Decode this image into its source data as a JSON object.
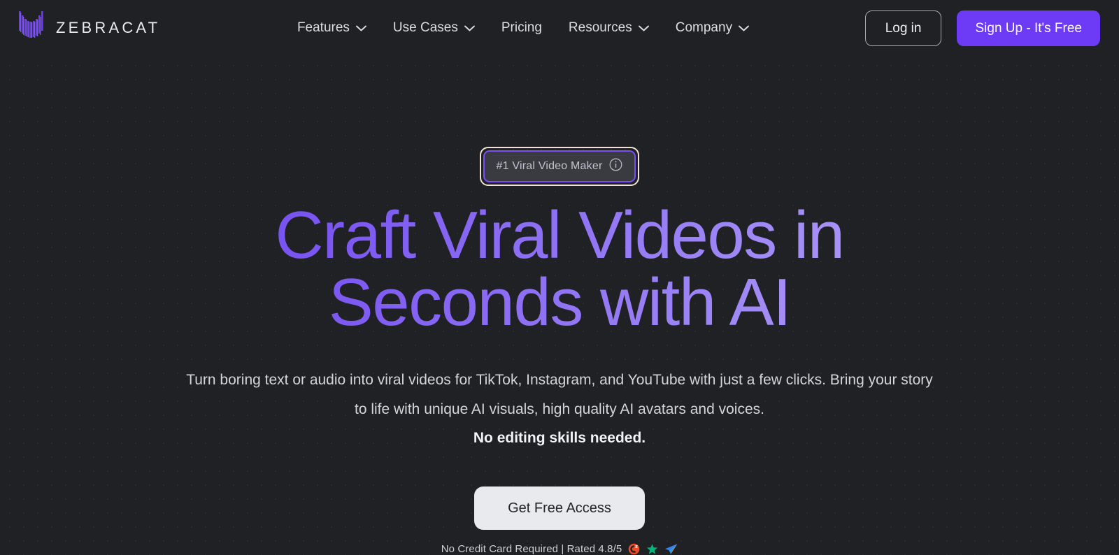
{
  "brand": {
    "name": "ZEBRACAT",
    "logo_icon": "zebracat-bars-logo",
    "accent": "#6d3bf5"
  },
  "nav": {
    "items": [
      {
        "label": "Features",
        "has_dropdown": true,
        "icon": "chevron-down-icon"
      },
      {
        "label": "Use Cases",
        "has_dropdown": true,
        "icon": "chevron-down-icon"
      },
      {
        "label": "Pricing",
        "has_dropdown": false,
        "icon": ""
      },
      {
        "label": "Resources",
        "has_dropdown": true,
        "icon": "chevron-down-icon"
      },
      {
        "label": "Company",
        "has_dropdown": true,
        "icon": "chevron-down-icon"
      }
    ]
  },
  "auth": {
    "login_label": "Log in",
    "signup_label": "Sign Up - It's Free",
    "signup_bg": "#6d3bf5"
  },
  "hero": {
    "badge": {
      "text": "#1 Viral Video Maker",
      "icon": "info-circle-icon",
      "border_color": "#7b4ef7",
      "focus_ring_color": "#f1e2d8"
    },
    "headline_line1": "Craft Viral Videos in",
    "headline_line2": "Seconds with AI",
    "headline_gradient_from": "#6a41e8",
    "headline_gradient_to": "#c0aff9",
    "subtitle": "Turn boring text or audio into viral videos for TikTok, Instagram, and YouTube with just a few clicks. Bring your story to life with unique AI visuals, high quality AI avatars and voices.",
    "subtitle_strong": "No editing skills needed.",
    "cta_label": "Get Free Access",
    "trust_text": "No Credit Card Required | Rated 4.8/5",
    "trust_icons": [
      {
        "name": "g2-icon",
        "color": "#ef4a28"
      },
      {
        "name": "trustpilot-star-icon",
        "color": "#00b67a"
      },
      {
        "name": "capterra-plane-icon",
        "color": "#3a7df5"
      }
    ]
  }
}
